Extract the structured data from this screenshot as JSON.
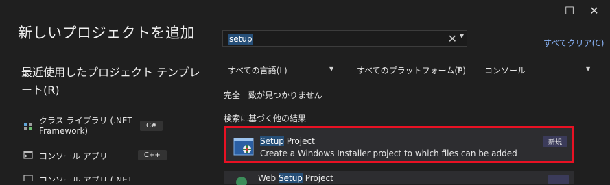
{
  "window": {
    "title": "新しいプロジェクトを追加",
    "restore_glyph": "☐",
    "close_glyph": "✕"
  },
  "recent": {
    "heading": "最近使用したプロジェクト テンプレート(R)",
    "items": [
      {
        "name": "クラス ライブラリ (.NET Framework)",
        "lang": "C#",
        "icon": "class-library-icon"
      },
      {
        "name": "コンソール アプリ",
        "lang": "C++",
        "icon": "console-app-icon"
      },
      {
        "name": "コンソール アプリ (.NET",
        "icon": "console-app-icon"
      }
    ]
  },
  "search": {
    "value": "setup",
    "clear_glyph": "✕",
    "clear_all": "すべてクリア(C)"
  },
  "filters": {
    "language": "すべての言語(L)",
    "platform": "すべてのプラットフォーム(P)",
    "project_type": "コンソール"
  },
  "results": {
    "no_exact_match": "完全一致が見つかりません",
    "other_results": "検索に基づく他の結果",
    "items": [
      {
        "name_highlight": "Setup",
        "name_rest": " Project",
        "description": "Create a Windows Installer project to which files can be added",
        "badge": "新規",
        "icon": "setup-project-icon"
      },
      {
        "name_prefix": "Web ",
        "name_highlight": "Setup",
        "name_rest": " Project",
        "icon": "web-setup-project-icon"
      }
    ]
  },
  "colors": {
    "background": "#1f1f1f",
    "highlight": "#264f78",
    "selection_border": "#e81123",
    "link": "#8ab4f8",
    "badge": "#3b3b5a"
  }
}
